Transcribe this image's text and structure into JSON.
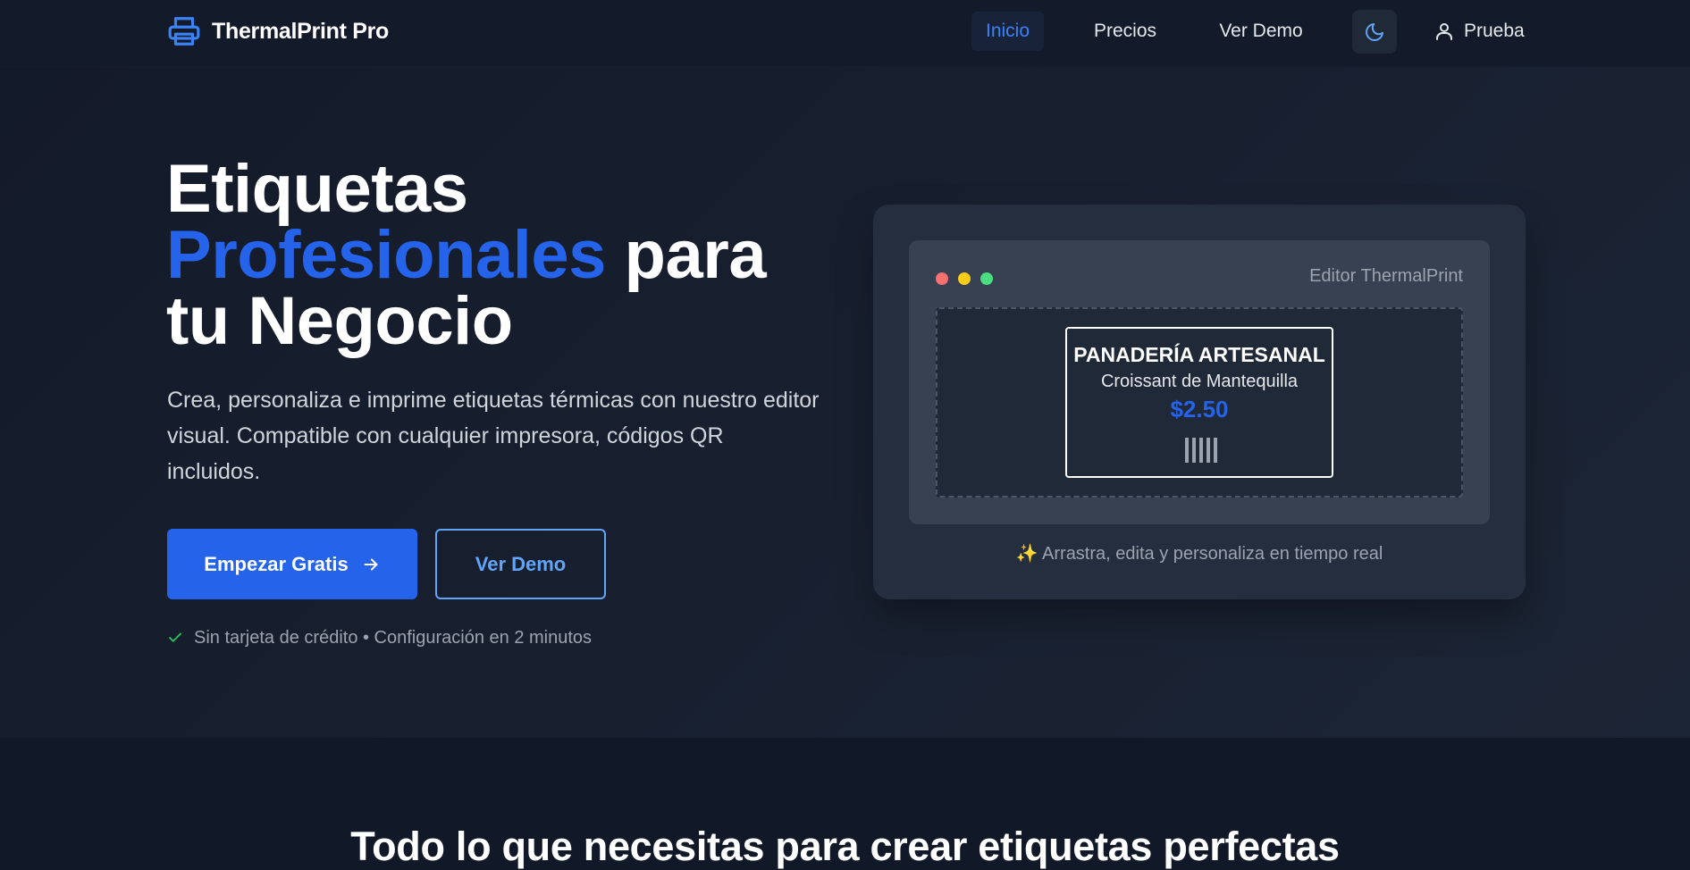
{
  "brand": {
    "name": "ThermalPrint Pro",
    "icon": "printer-icon",
    "color": "#3b82f6"
  },
  "nav": {
    "links": [
      {
        "label": "Inicio",
        "active": true
      },
      {
        "label": "Precios",
        "active": false
      },
      {
        "label": "Ver Demo",
        "active": false
      }
    ],
    "theme_toggle_icon": "moon-icon",
    "user_label": "Prueba",
    "user_icon": "user-icon"
  },
  "hero": {
    "headline_part1": "Etiquetas",
    "headline_accent": "Profesionales",
    "headline_part2": "para",
    "headline_part3": "tu Negocio",
    "subtext": "Crea, personaliza e imprime etiquetas térmicas con nuestro editor visual. Compatible con cualquier impresora, códigos QR incluidos.",
    "primary_button": "Empezar Gratis",
    "secondary_button": "Ver Demo",
    "note": "Sin tarjeta de crédito • Configuración en 2 minutos",
    "accent_color": "#2563eb"
  },
  "preview": {
    "window_title": "Editor ThermalPrint",
    "label": {
      "title": "PANADERÍA ARTESANAL",
      "product": "Croissant de Mantequilla",
      "price": "$2.50"
    },
    "caption": "✨ Arrastra, edita y personaliza en tiempo real"
  },
  "features": {
    "title": "Todo lo que necesitas para crear etiquetas perfectas"
  }
}
